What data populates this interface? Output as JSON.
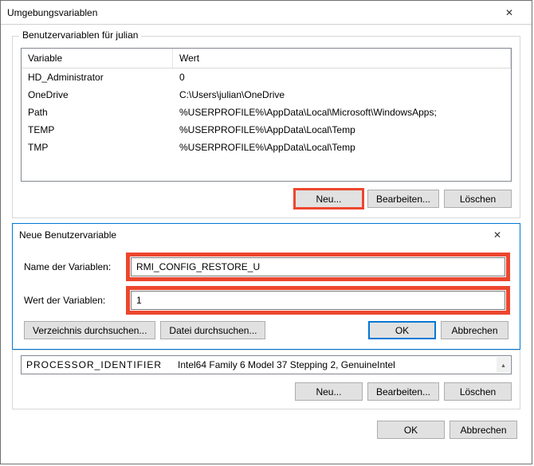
{
  "window": {
    "title": "Umgebungsvariablen"
  },
  "user_section": {
    "legend": "Benutzervariablen für julian",
    "columns": {
      "var": "Variable",
      "val": "Wert"
    },
    "rows": [
      {
        "var": "HD_Administrator",
        "val": "0"
      },
      {
        "var": "OneDrive",
        "val": "C:\\Users\\julian\\OneDrive"
      },
      {
        "var": "Path",
        "val": "%USERPROFILE%\\AppData\\Local\\Microsoft\\WindowsApps;"
      },
      {
        "var": "TEMP",
        "val": "%USERPROFILE%\\AppData\\Local\\Temp"
      },
      {
        "var": "TMP",
        "val": "%USERPROFILE%\\AppData\\Local\\Temp"
      }
    ],
    "buttons": {
      "new": "Neu...",
      "edit": "Bearbeiten...",
      "del": "Löschen"
    }
  },
  "new_dialog": {
    "title": "Neue Benutzervariable",
    "name_label": "Name der Variablen:",
    "value_label": "Wert der Variablen:",
    "name_value": "RMI_CONFIG_RESTORE_U",
    "value_value": "1",
    "browse_dir": "Verzeichnis durchsuchen...",
    "browse_file": "Datei durchsuchen...",
    "ok": "OK",
    "cancel": "Abbrechen"
  },
  "sys_section": {
    "peek_var": "PROCESSOR_IDENTIFIER",
    "peek_val": "Intel64 Family 6 Model 37 Stepping 2, GenuineIntel",
    "buttons": {
      "new": "Neu...",
      "edit": "Bearbeiten...",
      "del": "Löschen"
    }
  },
  "footer": {
    "ok": "OK",
    "cancel": "Abbrechen"
  }
}
